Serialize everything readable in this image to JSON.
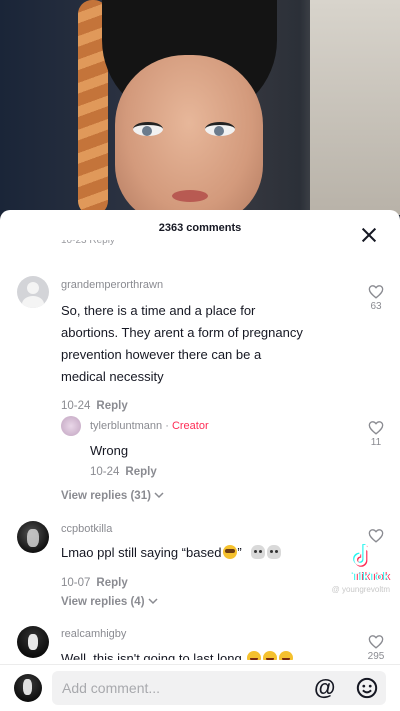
{
  "sheet": {
    "title": "2363 comments",
    "cut_text": "10-23 Reply"
  },
  "comments": [
    {
      "username": "grandemperorthrawn",
      "text_lines": [
        "So, there is a time and a place for",
        "abortions. They arent a form of pregnancy",
        "prevention however there can be a",
        "medical necessity"
      ],
      "date": "10-24",
      "reply_label": "Reply",
      "likes": "63",
      "replies": [
        {
          "username": "tylerbluntmann",
          "creator_label": "Creator",
          "separator": " · ",
          "text": "Wrong",
          "date": "10-24",
          "reply_label": "Reply",
          "likes": "11"
        }
      ],
      "view_replies": "View replies (31)"
    },
    {
      "username": "ccpbotkilla",
      "text": "Lmao ppl still saying “based",
      "text_close": "”",
      "date": "10-07",
      "reply_label": "Reply",
      "likes": "",
      "view_replies": "View replies (4)"
    },
    {
      "username": "realcamhigby",
      "text": "Well, this isn't going to last long",
      "likes": "295"
    }
  ],
  "watermark": {
    "wordmark": "TikTok",
    "handle": "@ youngrevoltm"
  },
  "composer": {
    "placeholder": "Add comment...",
    "mention_symbol": "@"
  },
  "colors": {
    "creator": "#fe2c55",
    "secondary_text": "#8a8b91",
    "primary_text": "#161823"
  }
}
